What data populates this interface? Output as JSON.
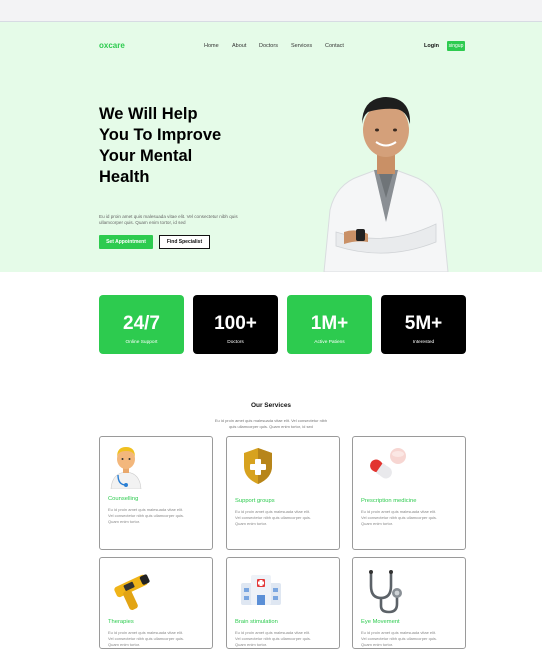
{
  "brand": {
    "logo": "oxcare",
    "accent": "#2dcb4f"
  },
  "nav": {
    "items": [
      "Home",
      "About",
      "Doctors",
      "Services",
      "Contact"
    ],
    "login": "Login",
    "signup": "singup"
  },
  "hero": {
    "title_lines": [
      "We Will Help",
      "You To Improve",
      "Your Mental",
      "Health"
    ],
    "description": "Eu id proin amet quis malesuada vitae elit. Vel consectetur nibh quis ullamcorper quis. Quam enim tortor, id sed",
    "cta_primary": "Set Appointment",
    "cta_secondary": "Find Specialist"
  },
  "stats": [
    {
      "value": "24/7",
      "label": "Online Support",
      "style": "green"
    },
    {
      "value": "100+",
      "label": "Doctors",
      "style": "black"
    },
    {
      "value": "1M+",
      "label": "Active Patiens",
      "style": "green"
    },
    {
      "value": "5M+",
      "label": "Interested",
      "style": "black"
    }
  ],
  "services": {
    "title": "Our Services",
    "subtitle": "Eu id proin amet quis malesuada vitae elit. Vel consectetur nibh quis ullamcorper quis. Quam enim tortor, id sed",
    "card_text": "Eu id proin amet quis malesuada vitae elit. Vel consectetur nibh quis ullamcorper quis. Quam enim tortor.",
    "cards": [
      {
        "title": "Counselling",
        "icon": "doctor-avatar-icon"
      },
      {
        "title": "Support groups",
        "icon": "shield-cross-icon"
      },
      {
        "title": "Prescription medicine",
        "icon": "pills-icon"
      },
      {
        "title": "Therapies",
        "icon": "thermometer-gun-icon"
      },
      {
        "title": "Brain stimulation",
        "icon": "hospital-icon"
      },
      {
        "title": "Eye Movement",
        "icon": "stethoscope-icon"
      }
    ]
  }
}
